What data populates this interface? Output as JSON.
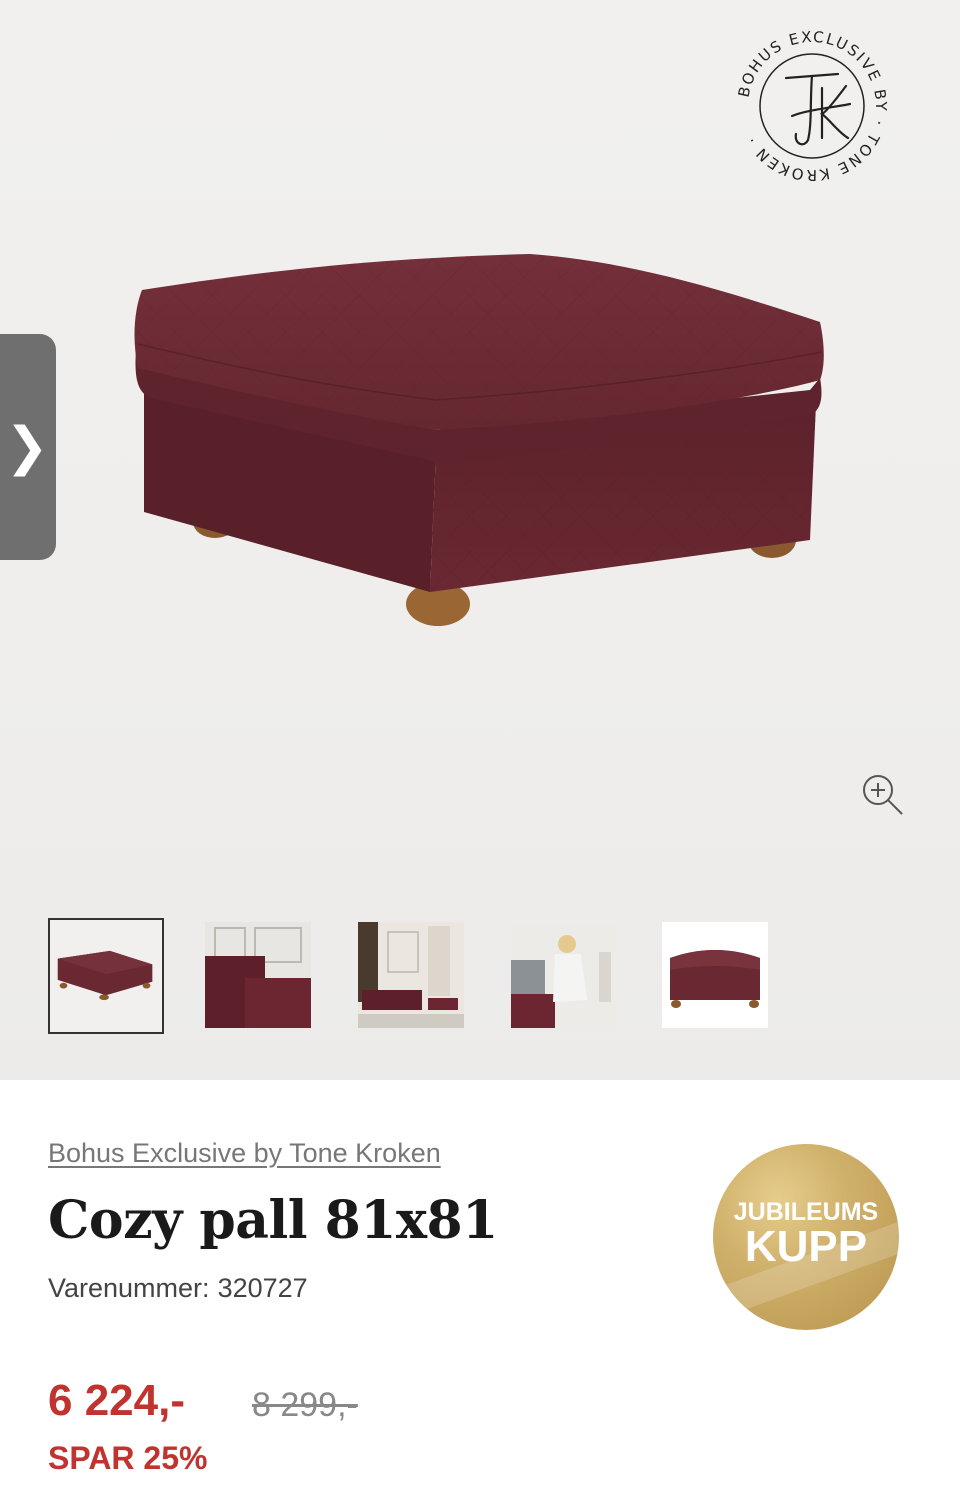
{
  "gallery": {
    "prev_icon": "chevron-right-icon",
    "prev_glyph": "❯",
    "seal": {
      "text": "BOHUS EXCLUSIVE BY · TONE KROKEN ·",
      "monogram": "TK"
    },
    "zoom_icon": "zoom-in-icon",
    "thumbnails": [
      {
        "name": "thumbnail-ottoman",
        "active": true
      },
      {
        "name": "thumbnail-sofa-closeup",
        "active": false
      },
      {
        "name": "thumbnail-living-room",
        "active": false
      },
      {
        "name": "thumbnail-person-sitting",
        "active": false
      },
      {
        "name": "thumbnail-ottoman-front",
        "active": false
      }
    ]
  },
  "product": {
    "brand": "Bohus Exclusive by Tone Kroken",
    "title": "Cozy pall 81x81",
    "sku_label": "Varenummer:",
    "sku": "320727",
    "price": "6 224,-",
    "old_price": "8 299,-",
    "savings": "SPAR 25%"
  },
  "badge": {
    "line1": "JUBILEUMS",
    "line2": "KUPP"
  },
  "colors": {
    "price": "#c0332e",
    "fabric": "#6b2a33",
    "badge_gold": "#c9a65e",
    "tab_gray": "#6f6f6f"
  }
}
